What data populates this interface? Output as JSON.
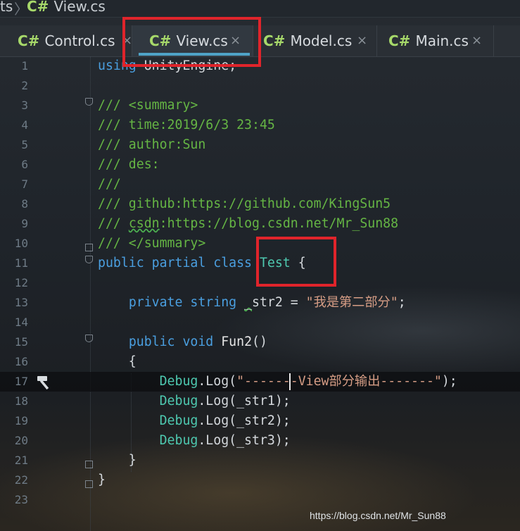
{
  "breadcrumb": {
    "segments": [
      "ts",
      "View.cs"
    ],
    "file_icon": "csharp-icon"
  },
  "tabs": [
    {
      "label": "Control.cs",
      "icon": "csharp-icon",
      "close": "×",
      "active": false
    },
    {
      "label": "View.cs",
      "icon": "csharp-icon",
      "close": "×",
      "active": true
    },
    {
      "label": "Model.cs",
      "icon": "csharp-icon",
      "close": "×",
      "active": false
    },
    {
      "label": "Main.cs",
      "icon": "csharp-icon",
      "close": "×",
      "active": false
    }
  ],
  "cs_mark": "C#",
  "lines": [
    {
      "n": "1",
      "tokens": [
        [
          "kw",
          "using"
        ],
        [
          "p",
          " UnityEngine;"
        ]
      ]
    },
    {
      "n": "2",
      "tokens": []
    },
    {
      "n": "3",
      "tokens": [
        [
          "cm",
          "/// <summary>"
        ]
      ]
    },
    {
      "n": "4",
      "tokens": [
        [
          "cm",
          "/// time:2019/6/3 23:45"
        ]
      ]
    },
    {
      "n": "5",
      "tokens": [
        [
          "cm",
          "/// author:Sun"
        ]
      ]
    },
    {
      "n": "6",
      "tokens": [
        [
          "cm",
          "/// des:"
        ]
      ]
    },
    {
      "n": "7",
      "tokens": [
        [
          "cm",
          "///"
        ]
      ]
    },
    {
      "n": "8",
      "tokens": [
        [
          "cm",
          "/// github:https://github.com/KingSun5"
        ]
      ]
    },
    {
      "n": "9",
      "tokens": [
        [
          "cm",
          "/// "
        ],
        [
          "cmsq",
          "csdn"
        ],
        [
          "cm",
          ":https://blog.csdn.net/Mr_Sun88"
        ]
      ]
    },
    {
      "n": "10",
      "tokens": [
        [
          "cm",
          "/// </summary>"
        ]
      ]
    },
    {
      "n": "11",
      "tokens": [
        [
          "kw",
          "public partial class "
        ],
        [
          "ty",
          "Test"
        ],
        [
          "p",
          " {"
        ]
      ]
    },
    {
      "n": "12",
      "tokens": []
    },
    {
      "n": "13",
      "tokens": [
        [
          "p",
          "    "
        ],
        [
          "kw",
          "private string "
        ],
        [
          "psq",
          "_"
        ],
        [
          "p",
          "str2 = "
        ],
        [
          "str",
          "\"我是第二部分\""
        ],
        [
          "p",
          ";"
        ]
      ]
    },
    {
      "n": "14",
      "tokens": []
    },
    {
      "n": "15",
      "tokens": [
        [
          "p",
          "    "
        ],
        [
          "kw",
          "public void "
        ],
        [
          "fn",
          "Fun2"
        ],
        [
          "p",
          "()"
        ]
      ]
    },
    {
      "n": "16",
      "tokens": [
        [
          "p",
          "    {"
        ]
      ]
    },
    {
      "n": "17",
      "tokens": [
        [
          "p",
          "        "
        ],
        [
          "ty",
          "Debug"
        ],
        [
          "p",
          ".Log("
        ],
        [
          "str",
          "\"-------View部分输出-------\""
        ],
        [
          "p",
          ");"
        ]
      ]
    },
    {
      "n": "18",
      "tokens": [
        [
          "p",
          "        "
        ],
        [
          "ty",
          "Debug"
        ],
        [
          "p",
          ".Log(_str1);"
        ]
      ]
    },
    {
      "n": "19",
      "tokens": [
        [
          "p",
          "        "
        ],
        [
          "ty",
          "Debug"
        ],
        [
          "p",
          ".Log(_str2);"
        ]
      ]
    },
    {
      "n": "20",
      "tokens": [
        [
          "p",
          "        "
        ],
        [
          "ty",
          "Debug"
        ],
        [
          "p",
          ".Log(_str3);"
        ]
      ]
    },
    {
      "n": "21",
      "tokens": [
        [
          "p",
          "    }"
        ]
      ]
    },
    {
      "n": "22",
      "tokens": [
        [
          "p",
          "}"
        ]
      ]
    },
    {
      "n": "23",
      "tokens": []
    }
  ],
  "current_line": "17",
  "gutter_icon": "hammer-icon",
  "watermark": "https://blog.csdn.net/Mr_Sun88",
  "colors": {
    "keyword": "#4a9fe0",
    "comment": "#65b544",
    "type": "#4ec9b0",
    "string": "#d69d85",
    "highlight": "#e0242b",
    "tab_accent": "#4fa3c7"
  }
}
